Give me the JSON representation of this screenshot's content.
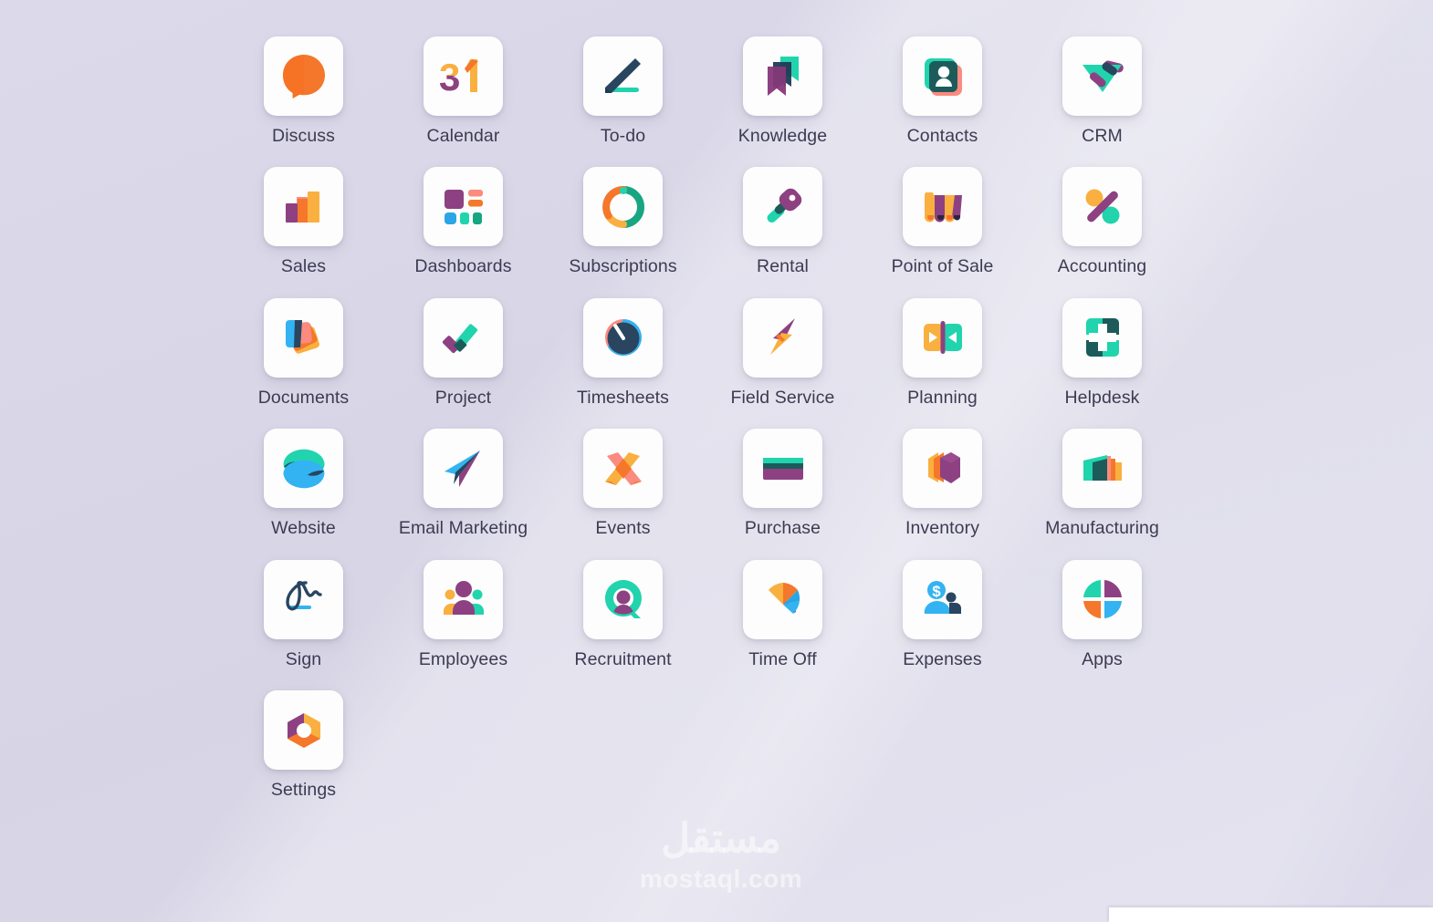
{
  "wallpaper": {
    "base_color": "#d9d7e7",
    "tile_color": "#fdfdfd",
    "label_color": "#3c3b52"
  },
  "apps": [
    {
      "label": "Discuss",
      "icon": "discuss-icon"
    },
    {
      "label": "Calendar",
      "icon": "calendar-icon",
      "glyph": "31"
    },
    {
      "label": "To-do",
      "icon": "todo-icon"
    },
    {
      "label": "Knowledge",
      "icon": "knowledge-icon"
    },
    {
      "label": "Contacts",
      "icon": "contacts-icon"
    },
    {
      "label": "CRM",
      "icon": "crm-icon"
    },
    {
      "label": "Sales",
      "icon": "sales-icon"
    },
    {
      "label": "Dashboards",
      "icon": "dashboards-icon"
    },
    {
      "label": "Subscriptions",
      "icon": "subscriptions-icon"
    },
    {
      "label": "Rental",
      "icon": "rental-icon"
    },
    {
      "label": "Point of Sale",
      "icon": "point-of-sale-icon"
    },
    {
      "label": "Accounting",
      "icon": "accounting-icon"
    },
    {
      "label": "Documents",
      "icon": "documents-icon"
    },
    {
      "label": "Project",
      "icon": "project-icon"
    },
    {
      "label": "Timesheets",
      "icon": "timesheets-icon"
    },
    {
      "label": "Field Service",
      "icon": "field-service-icon"
    },
    {
      "label": "Planning",
      "icon": "planning-icon"
    },
    {
      "label": "Helpdesk",
      "icon": "helpdesk-icon"
    },
    {
      "label": "Website",
      "icon": "website-icon"
    },
    {
      "label": "Email Marketing",
      "icon": "email-marketing-icon"
    },
    {
      "label": "Events",
      "icon": "events-icon"
    },
    {
      "label": "Purchase",
      "icon": "purchase-icon"
    },
    {
      "label": "Inventory",
      "icon": "inventory-icon"
    },
    {
      "label": "Manufacturing",
      "icon": "manufacturing-icon"
    },
    {
      "label": "Sign",
      "icon": "sign-icon"
    },
    {
      "label": "Employees",
      "icon": "employees-icon"
    },
    {
      "label": "Recruitment",
      "icon": "recruitment-icon"
    },
    {
      "label": "Time Off",
      "icon": "time-off-icon"
    },
    {
      "label": "Expenses",
      "icon": "expenses-icon"
    },
    {
      "label": "Apps",
      "icon": "apps-icon"
    },
    {
      "label": "Settings",
      "icon": "settings-icon"
    }
  ],
  "watermark": {
    "arabic": "مستقل",
    "latin": "mostaql.com"
  },
  "palette": {
    "orange": "#f4772b",
    "amber": "#f9b040",
    "purple": "#8d4182",
    "teal": "#21d4ad",
    "green": "#18a582",
    "navy": "#29455f",
    "darkteal": "#1d5b5b",
    "salmon": "#fb8a7f",
    "blue": "#33b3f1",
    "skyblue": "#2aa5e5"
  }
}
